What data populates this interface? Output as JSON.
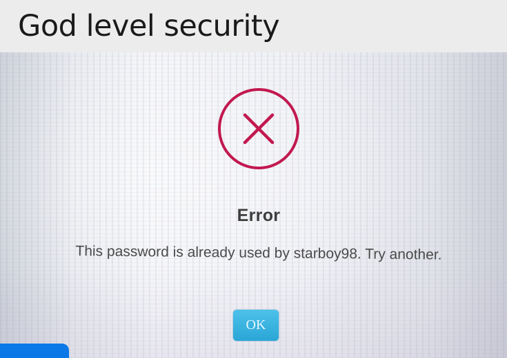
{
  "caption": {
    "text": "God level security"
  },
  "dialog": {
    "icon": "error-x-circle-icon",
    "title": "Error",
    "message": "This password is already used by starboy98. Try another.",
    "ok_label": "OK"
  },
  "colors": {
    "icon_red": "#c2184f",
    "button_blue": "#2aa6d6",
    "caption_bar": "#ececec",
    "corner_blue": "#0a78e6"
  }
}
